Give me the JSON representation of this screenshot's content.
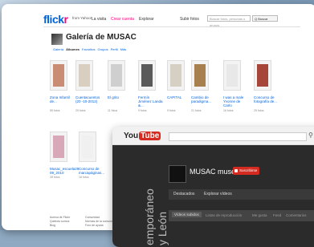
{
  "flickr": {
    "logo_main": "flick",
    "logo_accent": "r",
    "from": "from Yahoo!",
    "nav": [
      "La visita",
      "Crear cuenta",
      "Explorar"
    ],
    "nav_right": "Subir fotos",
    "search_placeholder": "Buscar fotos, personas o grupos",
    "search_button": "Q Buscar",
    "gallery_title": "Galería de MUSAC",
    "tabs": [
      "Galería",
      "Álbumes",
      "Favoritos",
      "Grupos",
      "Perfil",
      "Más"
    ],
    "photos": [
      {
        "caption": "Zona Infantil de...",
        "count": "55 fotos",
        "color": "#c98d76"
      },
      {
        "caption": "Cuentacuentos (20 -10-2012)",
        "count": "29 fotos",
        "color": "#d9cfc1"
      },
      {
        "caption": "El grito",
        "count": "11 fotos",
        "color": "#cfcfcf"
      },
      {
        "caption": "Fermín Jiménez Landa &...",
        "count": "9 fotos",
        "color": "#5a5a5a"
      },
      {
        "caption": "CAPITAL",
        "count": "9 fotos",
        "color": "#d6d0c4"
      },
      {
        "caption": "Cambio de paradigma...",
        "count": "21 fotos",
        "color": "#a88050"
      },
      {
        "caption": "I was a male Yvonne de Carlo",
        "count": "16 fotos",
        "color": "#e8e8e8"
      },
      {
        "caption": "Concurso de fotografía de...",
        "count": "25 fotos",
        "color": "#a6453a"
      },
      {
        "caption": "Musac_escuela29 09_2010",
        "count": "28 fotos",
        "color": "#d8a8b8"
      },
      {
        "caption": "Concurso de marcapáginas...",
        "count": "16 fotos",
        "color": "#f0f0f0"
      }
    ],
    "footer_left": [
      "Acerca de Flickr",
      "Quiénes somos",
      "Blog"
    ],
    "footer_mid": [
      "Comunidad",
      "Normas de la comunidad",
      "Foro de ayuda"
    ]
  },
  "youtube": {
    "logo_you": "You",
    "logo_tube": "Tube",
    "channel_name": "MUSAC museo",
    "subscribe": "Suscribirse",
    "vertical_text": [
      "emporáneo",
      "y León"
    ],
    "nav": [
      "Destacados",
      "Explorar vídeos"
    ],
    "tabs": [
      "Vídeos subidos",
      "Listas de reproducción",
      "Me gusta",
      "Feed",
      "Comentarios"
    ]
  }
}
